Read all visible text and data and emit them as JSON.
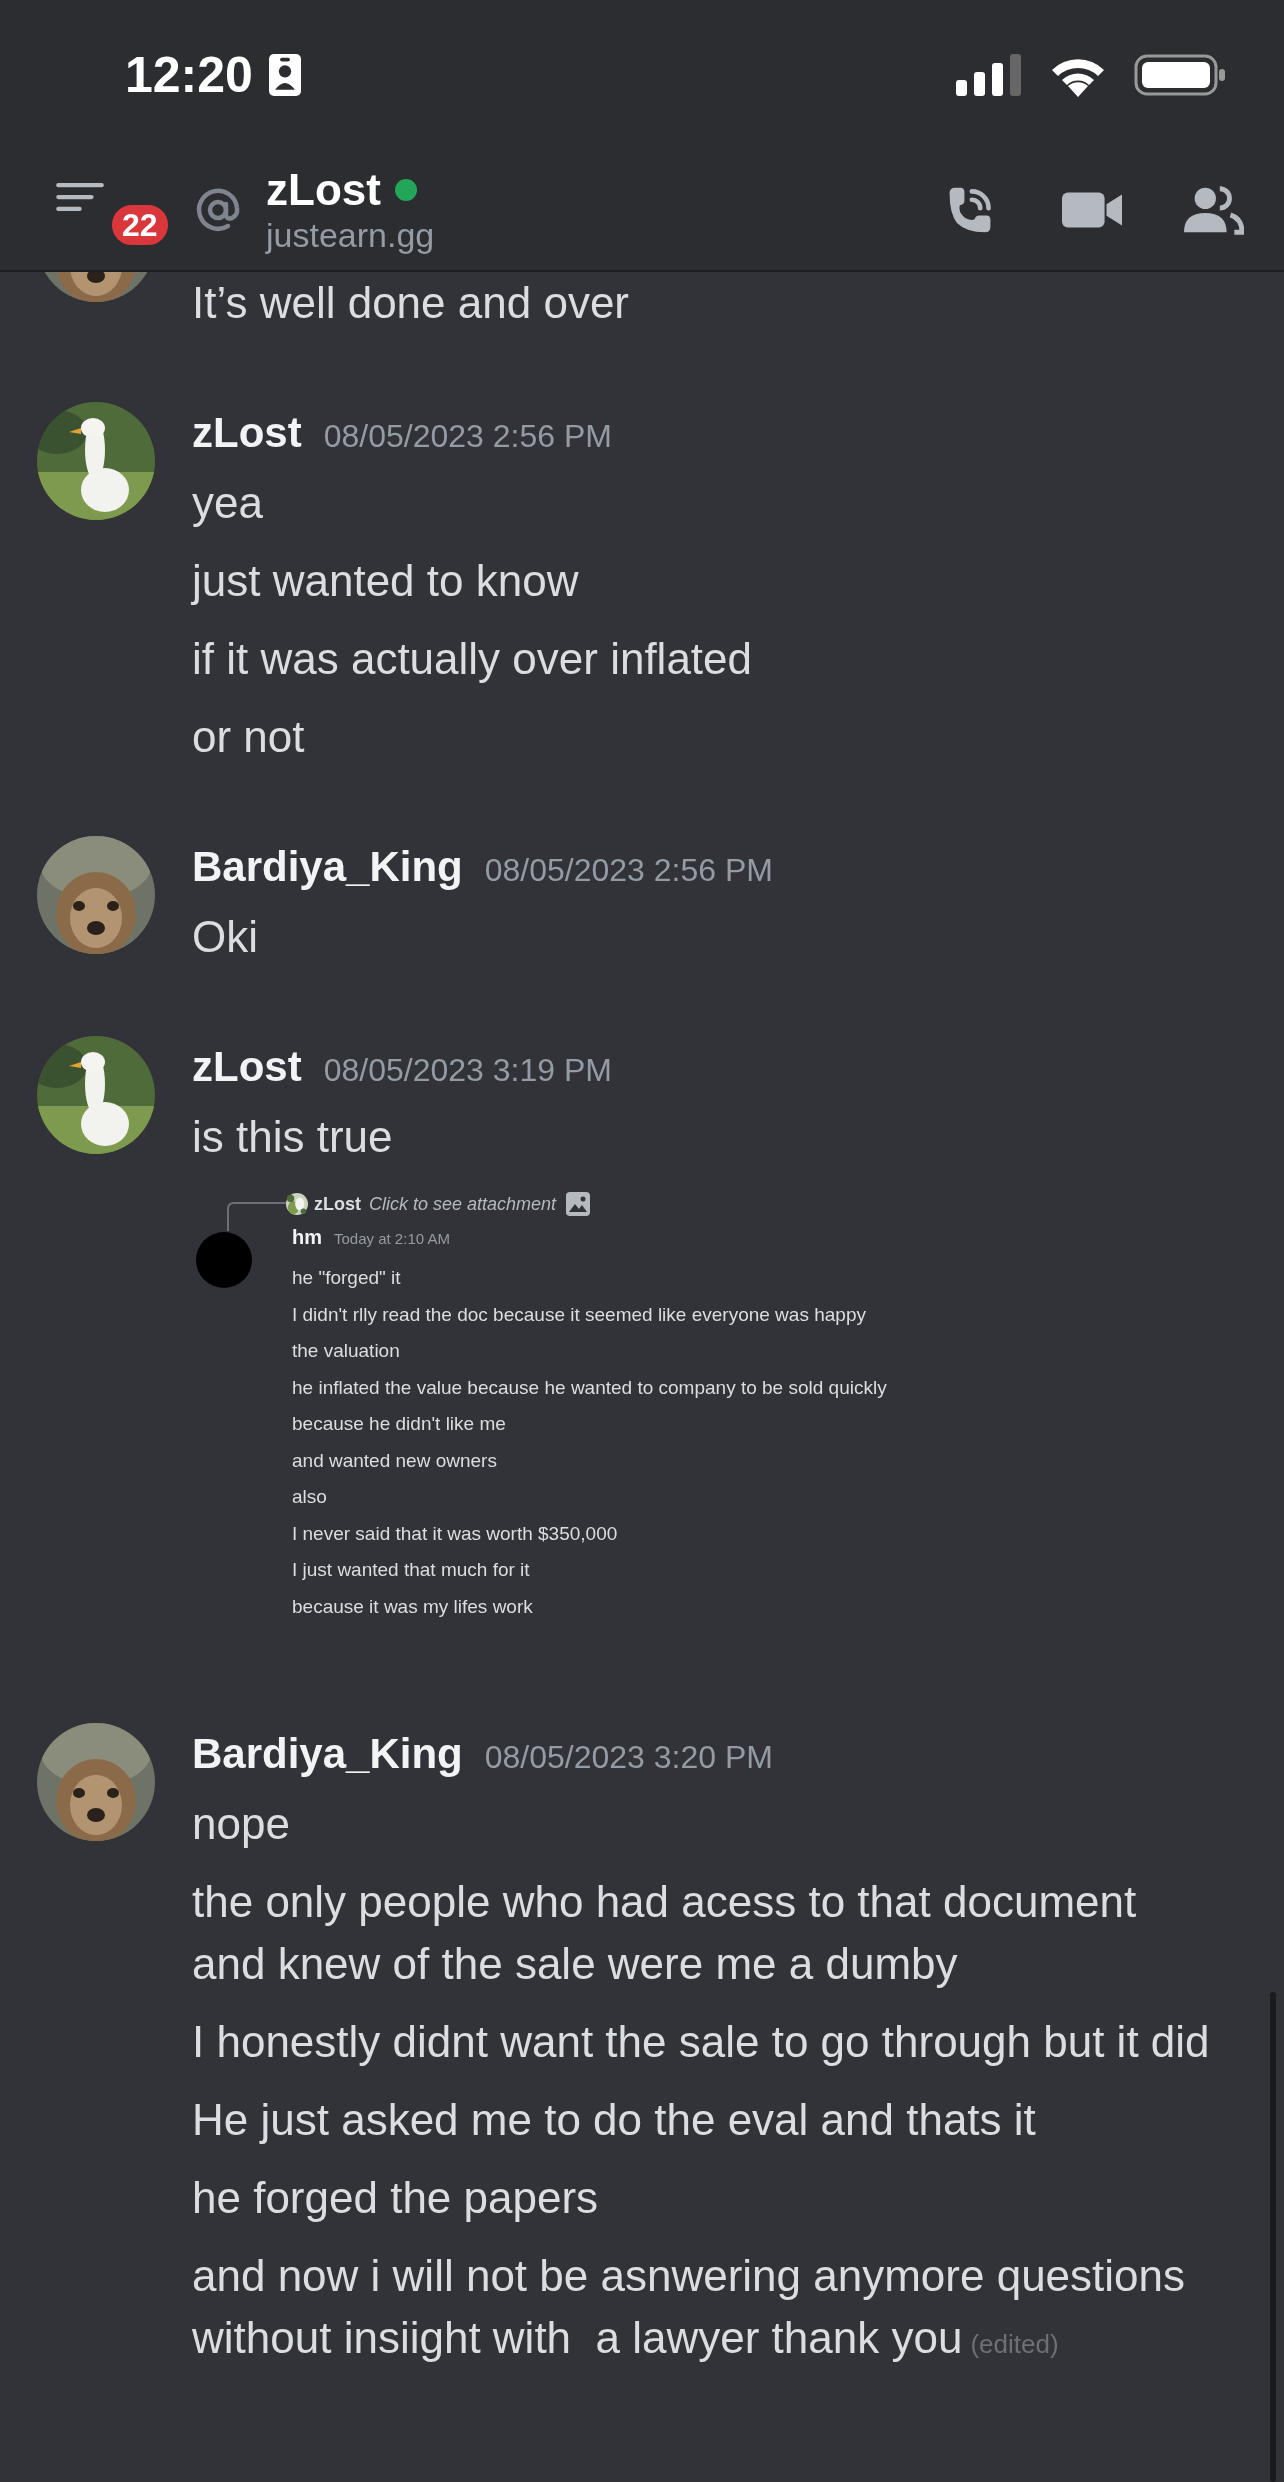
{
  "status_bar": {
    "time": "12:20"
  },
  "header": {
    "badge": "22",
    "name": "zLost",
    "online": true,
    "subtitle": "justearn.gg"
  },
  "messages": [
    {
      "kind": "continuation",
      "lines": [
        "It’s well done and over"
      ]
    },
    {
      "kind": "group",
      "author": "zLost",
      "timestamp": "08/05/2023 2:56 PM",
      "lines": [
        "yea",
        "just wanted to know",
        "if it was actually over inflated",
        "or not"
      ]
    },
    {
      "kind": "group",
      "author": "Bardiya_King",
      "timestamp": "08/05/2023 2:56 PM",
      "lines": [
        "Oki"
      ]
    },
    {
      "kind": "group",
      "author": "zLost",
      "timestamp": "08/05/2023 3:19 PM",
      "lines": [
        "is this true"
      ],
      "attachment": {
        "reply_author": "zLost",
        "reply_text": "Click to see attachment",
        "author": "hm",
        "timestamp": "Today at 2:10 AM",
        "lines": [
          "he \"forged\" it",
          "I didn't rlly read the doc because it seemed like everyone was happy",
          "the valuation",
          "he inflated the value because he wanted to company to be sold quickly",
          "because he didn't like me",
          "and wanted new owners",
          "also",
          "I never said that it was worth $350,000",
          "I just wanted that much for it",
          "because it was my lifes work"
        ]
      }
    },
    {
      "kind": "group",
      "author": "Bardiya_King",
      "timestamp": "08/05/2023 3:20 PM",
      "lines": [
        "nope",
        "the only people who had acess to that document and knew of the sale were me a dumby",
        "I honestly didnt want the sale to go through but it did",
        "He just asked me to do the eval and thats it",
        "he forged the papers",
        "and now i will not be asnwering anymore questions without insiight with  a lawyer thank you"
      ],
      "edited_label": "(edited)"
    }
  ]
}
